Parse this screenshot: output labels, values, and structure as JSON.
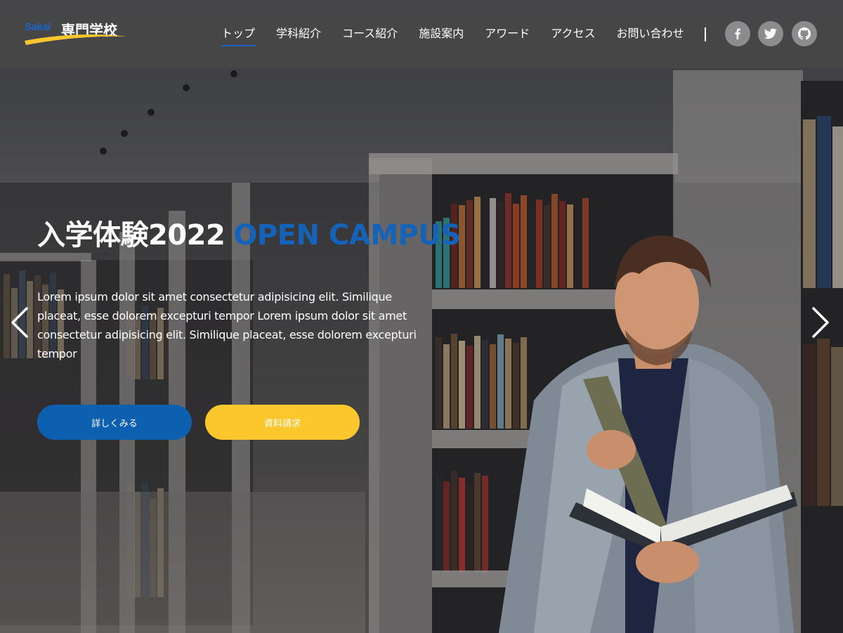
{
  "logo": {
    "en_text": "Sakai",
    "jp_text": "専門学校"
  },
  "nav": {
    "items": [
      {
        "label": "トップ",
        "active": true
      },
      {
        "label": "学科紹介"
      },
      {
        "label": "コース紹介"
      },
      {
        "label": "施設案内"
      },
      {
        "label": "アワード"
      },
      {
        "label": "アクセス"
      },
      {
        "label": "お問い合わせ"
      }
    ]
  },
  "social": [
    {
      "icon": "facebook-icon"
    },
    {
      "icon": "twitter-icon"
    },
    {
      "icon": "github-icon"
    }
  ],
  "hero": {
    "title_main": "入学体験2022",
    "title_accent": "OPEN CAMPUS",
    "description": "Lorem ipsum dolor sit amet consectetur adipisicing elit. Similique placeat, esse dolorem excepturi tempor Lorem ipsum dolor sit amet consectetur adipisicing elit. Similique placeat, esse dolorem excepturi tempor",
    "primary_button": "詳しくみる",
    "secondary_button": "資料請求"
  },
  "carousel": {
    "prev_icon": "chevron-left-icon",
    "next_icon": "chevron-right-icon"
  },
  "colors": {
    "brand_blue": "#0d5fb0",
    "accent_yellow": "#fcc72d",
    "header_bg": "#464648"
  }
}
